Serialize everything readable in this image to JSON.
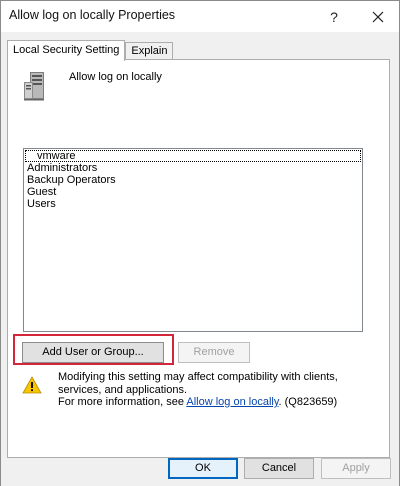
{
  "window": {
    "title": "Allow log on locally Properties",
    "help_glyph": "?",
    "close_glyph": "✕"
  },
  "tabs": [
    {
      "label": "Local Security Setting",
      "active": true
    },
    {
      "label": "Explain",
      "active": false
    }
  ],
  "policy": {
    "icon": "server-icon",
    "name": "Allow log on locally"
  },
  "accounts": {
    "items": [
      "vmware",
      "Administrators",
      "Backup Operators",
      "Guest",
      "Users"
    ],
    "selected_index": 0
  },
  "buttons": {
    "add": "Add User or Group...",
    "remove": "Remove",
    "ok": "OK",
    "cancel": "Cancel",
    "apply": "Apply"
  },
  "warning": {
    "icon": "warning-icon",
    "line1": "Modifying this setting may affect compatibility with clients, services, and applications.",
    "more_prefix": "For more information, see ",
    "link_text": "Allow log on locally",
    "more_suffix": ". (Q823659)"
  },
  "colors": {
    "highlight": "#d3263a",
    "link": "#0645ad",
    "default_button_border": "#0067c0"
  }
}
